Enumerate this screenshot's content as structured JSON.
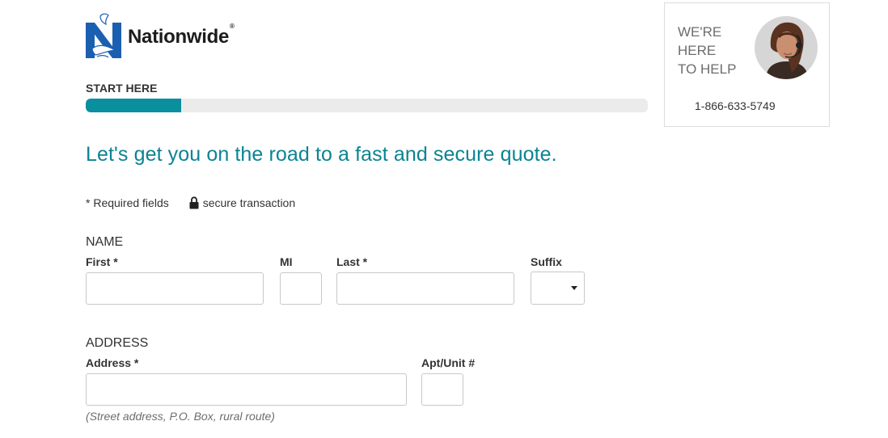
{
  "brand": {
    "name": "Nationwide",
    "reg": "®",
    "icon": "eagle-n-logo"
  },
  "progress": {
    "label": "START HERE",
    "value": 0.17,
    "fill_color": "#0a8f9e"
  },
  "help": {
    "heading_lines": [
      "WE'RE",
      "HERE",
      "TO HELP"
    ],
    "phone": "1-866-633-5749"
  },
  "headline": "Let's get you on the road to a fast and secure quote.",
  "meta": {
    "required": "* Required fields",
    "secure": "secure transaction"
  },
  "name_section": {
    "title": "NAME",
    "first_label": "First *",
    "mi_label": "MI",
    "last_label": "Last *",
    "suffix_label": "Suffix",
    "first_value": "",
    "mi_value": "",
    "last_value": "",
    "suffix_value": ""
  },
  "address_section": {
    "title": "ADDRESS",
    "address_label": "Address *",
    "apt_label": "Apt/Unit #",
    "address_value": "",
    "apt_value": "",
    "hint": "(Street address, P.O. Box, rural route)"
  },
  "colors": {
    "accent": "#0a8491",
    "border": "#c8c8c8",
    "text": "#333333"
  }
}
